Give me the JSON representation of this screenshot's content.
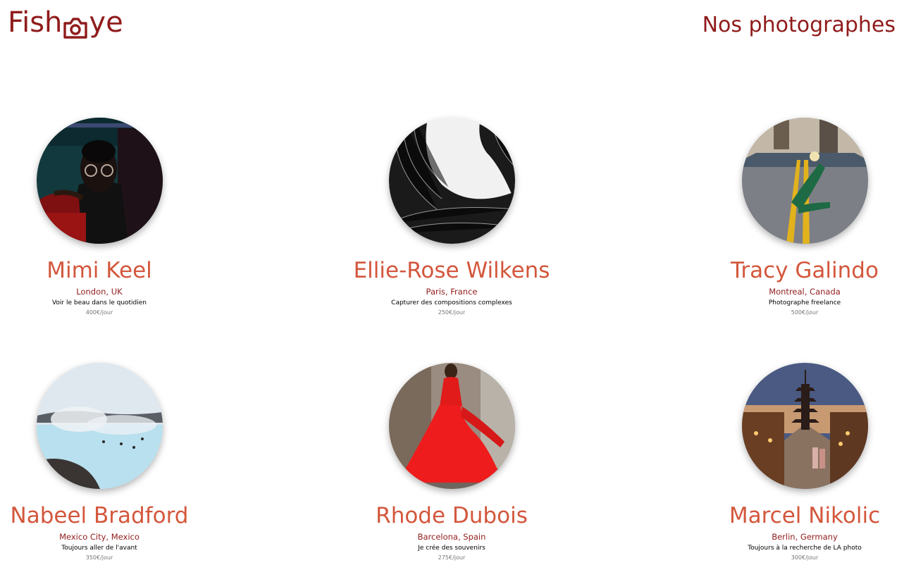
{
  "header": {
    "logo_text_left": "Fish",
    "logo_text_right": "ye",
    "logo_icon": "camera-icon",
    "page_title": "Nos photographes"
  },
  "colors": {
    "brand": "#901C1C",
    "accent": "#D3573C",
    "muted": "#757575"
  },
  "photographers": [
    {
      "name": "Mimi Keel",
      "location": "London, UK",
      "tagline": "Voir le beau dans le quotidien",
      "price": "400€/jour",
      "portrait_theme": "woman-with-glasses-red-seat"
    },
    {
      "name": "Ellie-Rose Wilkens",
      "location": "Paris, France",
      "tagline": "Capturer des compositions complexes",
      "price": "250€/jour",
      "portrait_theme": "black-white-architecture"
    },
    {
      "name": "Tracy Galindo",
      "location": "Montreal, Canada",
      "tagline": "Photographe freelance",
      "price": "500€/jour",
      "portrait_theme": "woman-on-city-road"
    },
    {
      "name": "Nabeel Bradford",
      "location": "Mexico City, Mexico",
      "tagline": "Toujours aller de l'avant",
      "price": "350€/jour",
      "portrait_theme": "geothermal-lagoon"
    },
    {
      "name": "Rhode Dubois",
      "location": "Barcelona, Spain",
      "tagline": "Je crée des souvenirs",
      "price": "275€/jour",
      "portrait_theme": "woman-in-red-dress"
    },
    {
      "name": "Marcel Nikolic",
      "location": "Berlin, Germany",
      "tagline": "Toujours à la recherche de LA photo",
      "price": "300€/jour",
      "portrait_theme": "pagoda-street-dusk"
    }
  ]
}
